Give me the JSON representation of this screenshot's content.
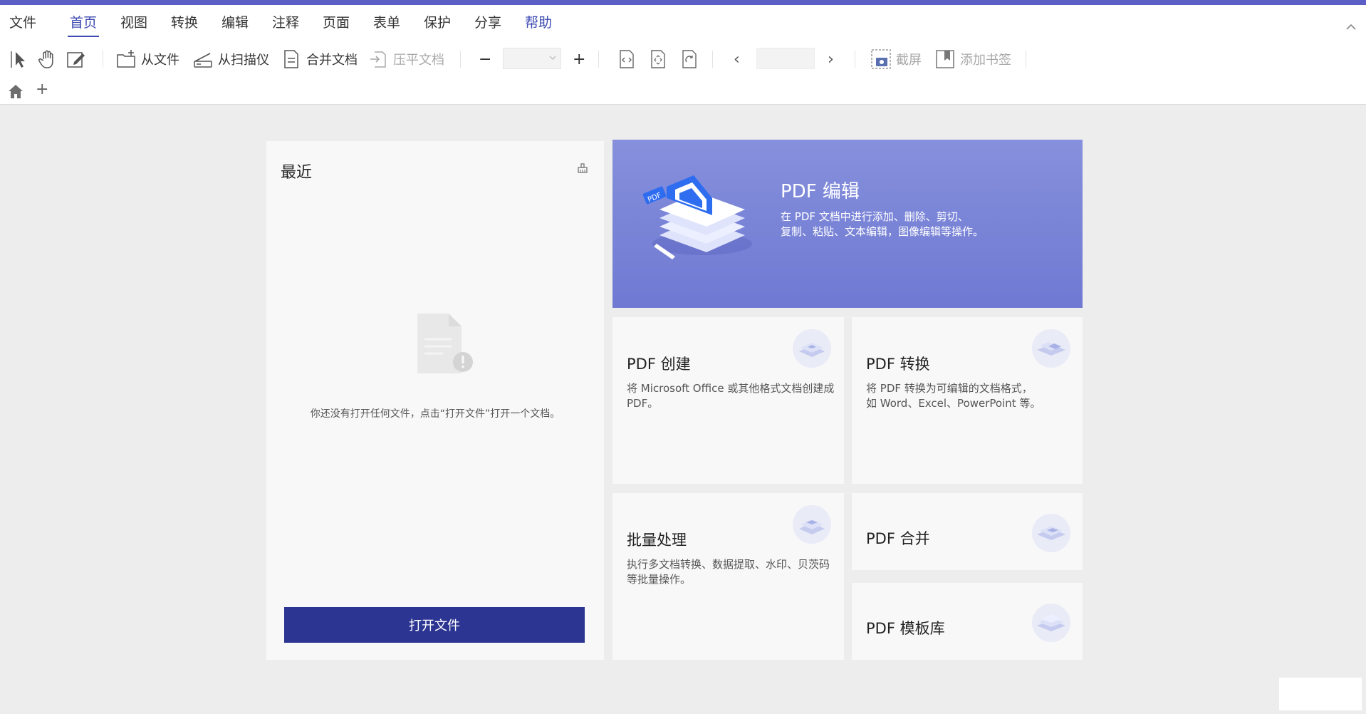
{
  "menu": {
    "file": "文件",
    "tabs": [
      "首页",
      "视图",
      "转换",
      "编辑",
      "注释",
      "页面",
      "表单",
      "保护",
      "分享",
      "帮助"
    ]
  },
  "toolbar": {
    "from_file": "从文件",
    "from_scanner": "从扫描仪",
    "merge_docs": "合并文档",
    "flatten_docs": "压平文档",
    "zoom_out": "−",
    "zoom_in": "+",
    "prev_page": "‹",
    "next_page": "›",
    "screenshot": "截屏",
    "add_bookmark": "添加书签"
  },
  "tabbar": {
    "add": "+"
  },
  "recent": {
    "title": "最近",
    "empty_text": "你还没有打开任何文件，点击“打开文件”打开一个文档。",
    "open_button": "打开文件"
  },
  "features": {
    "edit": {
      "title": "PDF 编辑",
      "desc": "在 PDF 文档中进行添加、删除、剪切、\n复制、粘贴、文本编辑，图像编辑等操作。",
      "art_label": "PDF"
    },
    "create": {
      "title": "PDF 创建",
      "desc": "将 Microsoft Office 或其他格式文档创建成\nPDF。"
    },
    "convert": {
      "title": "PDF 转换",
      "desc": "将 PDF 转换为可编辑的文档格式，\n如 Word、Excel、PowerPoint 等。"
    },
    "batch": {
      "title": "批量处理",
      "desc": "执行多文档转换、数据提取、水印、贝茨码\n等批量操作。"
    },
    "merge": {
      "title": "PDF 合并"
    },
    "templates": {
      "title": "PDF 模板库"
    }
  },
  "colors": {
    "accent": "#3d4ab2",
    "top_stripe": "#5c5fc6",
    "open_button": "#2c3592",
    "hero_top": "#8690dc",
    "hero_bottom": "#6f79d2"
  }
}
